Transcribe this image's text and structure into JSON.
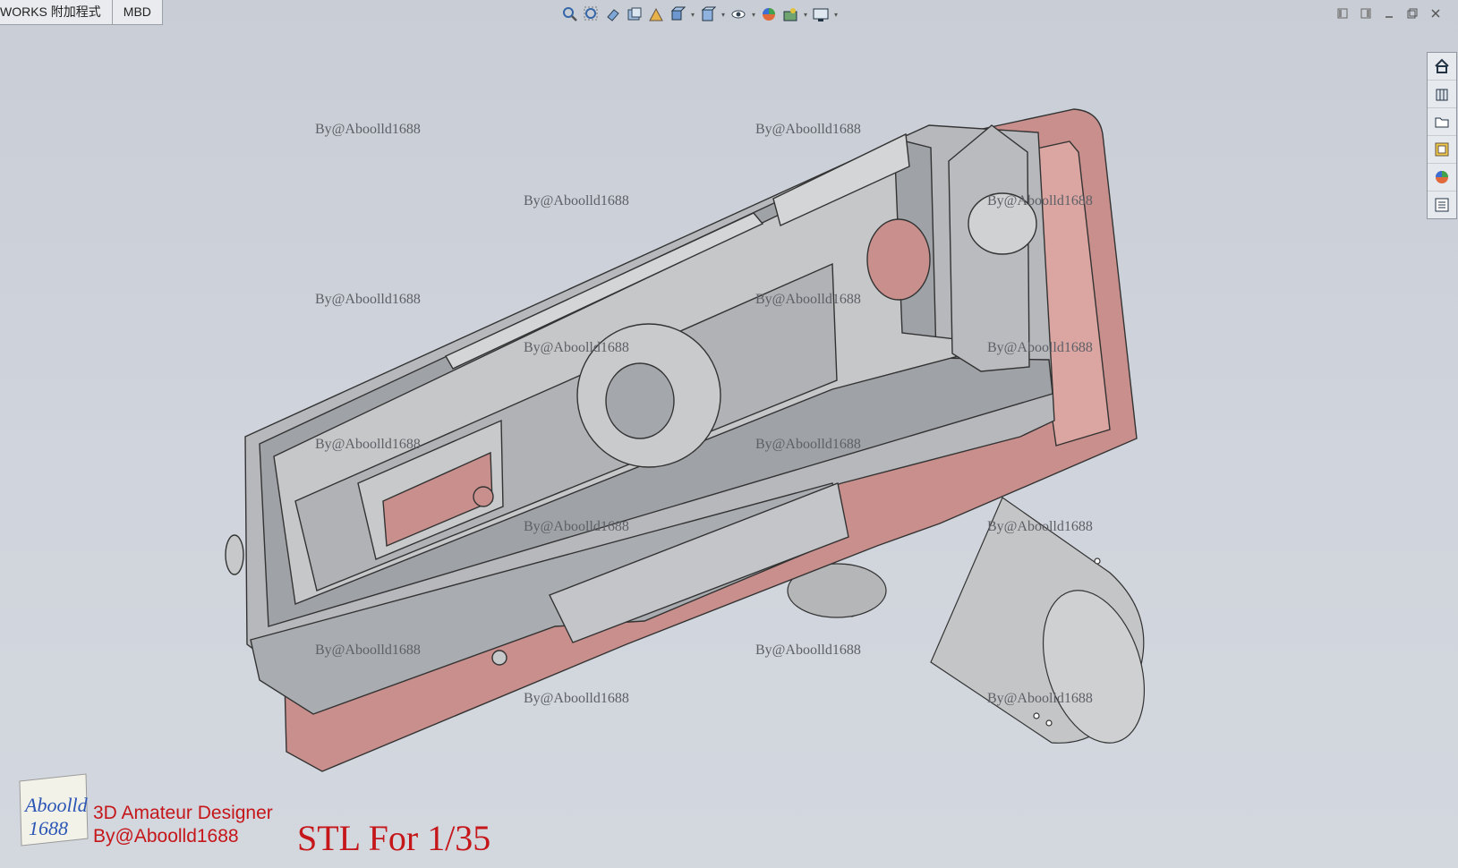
{
  "tabs": [
    {
      "label": "WORKS 附加程式"
    },
    {
      "label": "MBD"
    }
  ],
  "toolbar": {
    "icons": [
      "zoom-to-fit-icon",
      "zoom-area-icon",
      "previous-view-icon",
      "section-view-icon",
      "dynamic-annotation-icon",
      "view-orientation-icon",
      "display-style-icon",
      "hide-show-icon",
      "edit-appearance-icon",
      "apply-scene-icon",
      "view-settings-icon"
    ]
  },
  "task_pane": {
    "icons": [
      "home-icon",
      "3d-parts-icon",
      "file-explorer-icon",
      "design-library-icon",
      "appearances-icon",
      "custom-properties-icon"
    ]
  },
  "watermark": "By@Aboolld1688",
  "branding": {
    "logo_text_top": "Aboolld",
    "logo_text_bottom": "1688",
    "line1": "3D Amateur Designer",
    "line2": "By@Aboolld1688",
    "caption": "STL For 1/35"
  },
  "colors": {
    "accent_red": "#c5161a",
    "part_gray": "#b9bbbe",
    "part_pink": "#c98f8c"
  }
}
